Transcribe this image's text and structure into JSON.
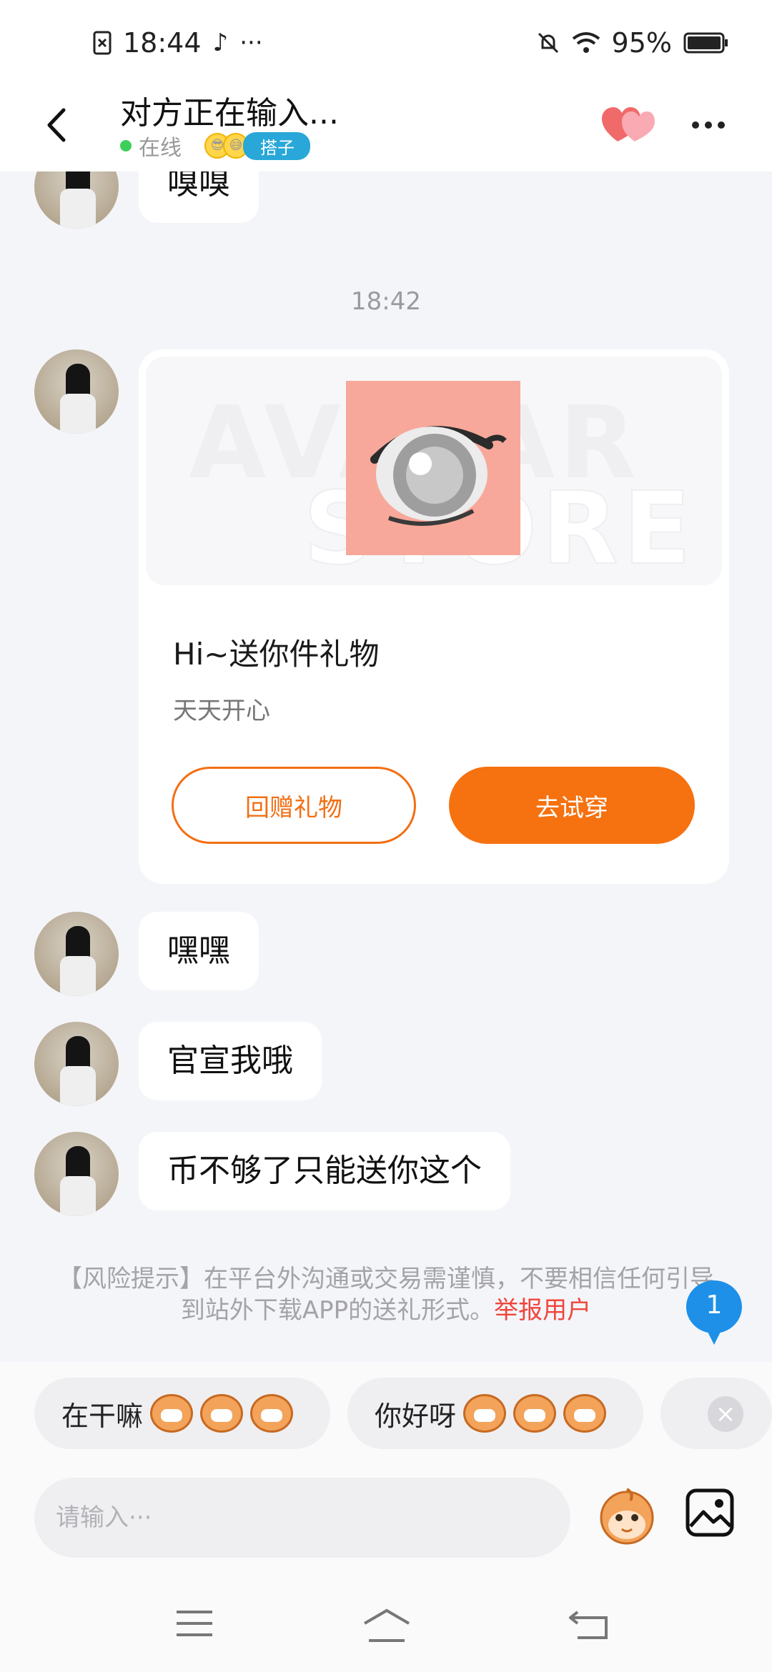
{
  "status_bar": {
    "time": "18:44",
    "battery": "95%"
  },
  "header": {
    "title": "对方正在输入...",
    "status": "在线",
    "badge": "搭子"
  },
  "messages": [
    {
      "type": "text",
      "text": "嗅嗅"
    },
    {
      "type": "time",
      "text": "18:42"
    },
    {
      "type": "gift",
      "title": "Hi~送你件礼物",
      "subtitle": "天天开心",
      "watermark": "AVATAR STORE",
      "return_label": "回赠礼物",
      "try_label": "去试穿"
    },
    {
      "type": "text",
      "text": "嘿嘿"
    },
    {
      "type": "text",
      "text": "官宣我哦"
    },
    {
      "type": "text",
      "text": "币不够了只能送你这个"
    }
  ],
  "risk_notice": {
    "text": "【风险提示】在平台外沟通或交易需谨慎，不要相信任何引导到站外下载APP的送礼形式。",
    "report_label": "举报用户"
  },
  "new_message_badge": "1",
  "quick_replies": [
    {
      "label": "在干嘛"
    },
    {
      "label": "你好呀"
    }
  ],
  "input": {
    "placeholder": "请输入···"
  },
  "colors": {
    "accent": "#f6710f",
    "online": "#3ecf5a",
    "report": "#f0453c",
    "badge": "#1e90e8"
  }
}
